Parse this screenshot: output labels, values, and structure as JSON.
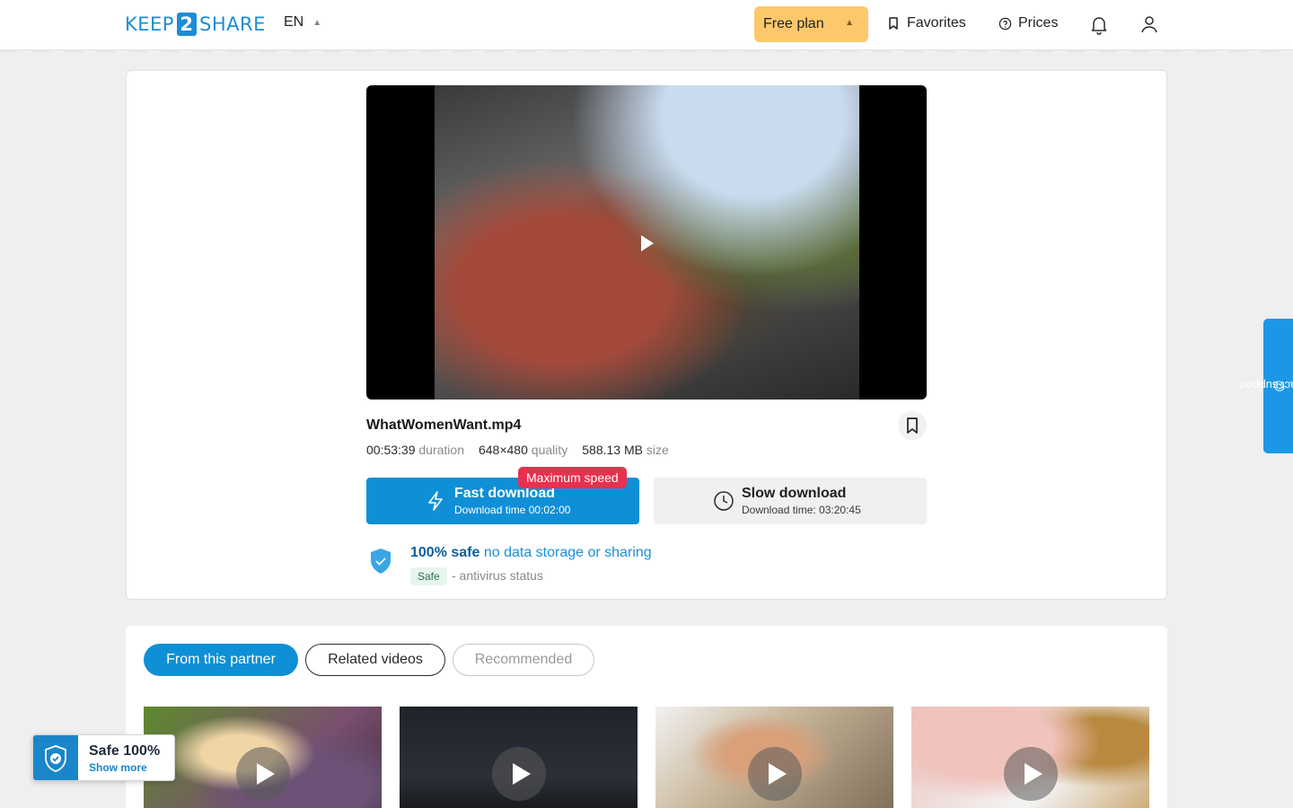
{
  "header": {
    "logo": {
      "left": "KEEP",
      "mid": "2",
      "right": "SHARE"
    },
    "language": "EN",
    "plan_label": "Free plan",
    "favorites_label": "Favorites",
    "prices_label": "Prices"
  },
  "file": {
    "name": "WhatWomenWant.mp4",
    "duration_value": "00:53:39",
    "duration_label": "duration",
    "quality_value": "648×480",
    "quality_label": "quality",
    "size_value": "588.13 MB",
    "size_label": "size"
  },
  "downloads": {
    "fast_title": "Fast download",
    "fast_sub": "Download time 00:02:00",
    "max_badge": "Maximum speed",
    "slow_title": "Slow download",
    "slow_sub": "Download time: 03:20:45"
  },
  "safety": {
    "bold": "100% safe",
    "rest": "no data storage or sharing",
    "badge": "Safe",
    "status": "- antivirus status"
  },
  "support_label": "contact support",
  "tabs": [
    {
      "label": "From this partner",
      "active": true
    },
    {
      "label": "Related videos",
      "active": false
    },
    {
      "label": "Recommended",
      "active": false
    }
  ],
  "safe_widget": {
    "title": "Safe 100%",
    "link": "Show more"
  },
  "colors": {
    "primary": "#0f8fd6",
    "plan": "#fdc86b",
    "badge": "#e8304f"
  }
}
